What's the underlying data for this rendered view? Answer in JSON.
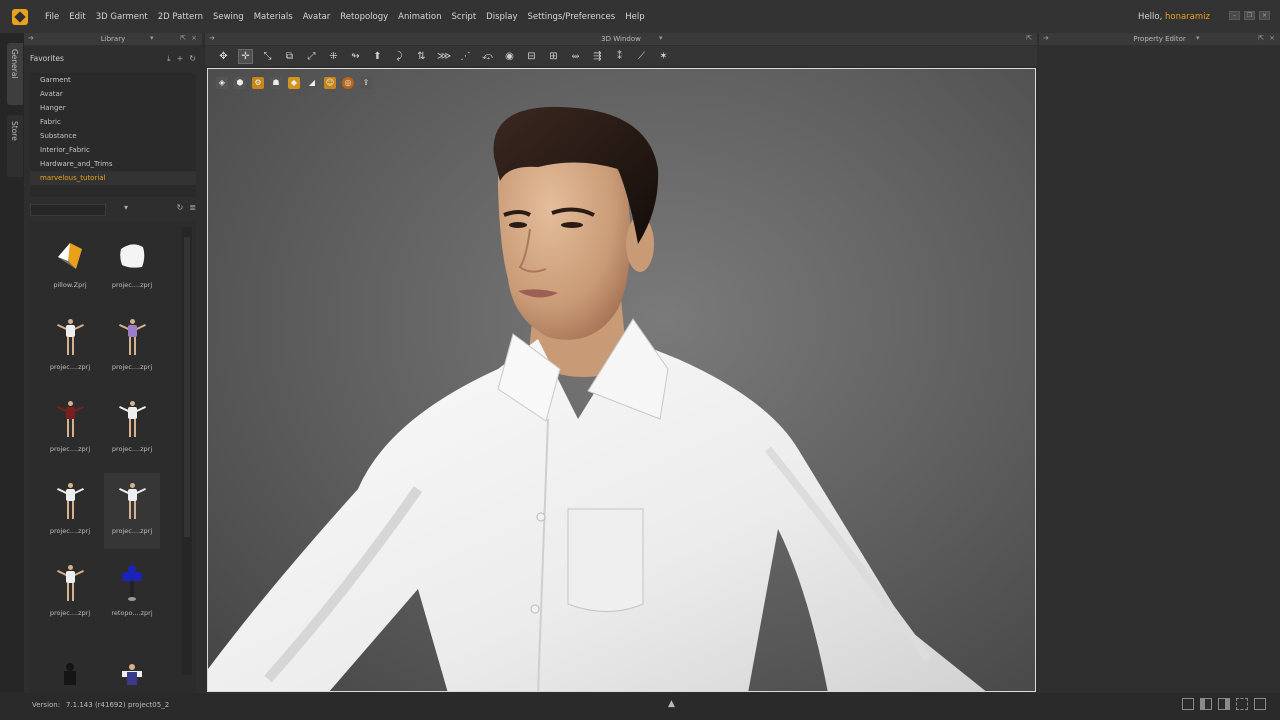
{
  "menu": {
    "items": [
      "File",
      "Edit",
      "3D Garment",
      "2D Pattern",
      "Sewing",
      "Materials",
      "Avatar",
      "Retopology",
      "Animation",
      "Script",
      "Display",
      "Settings/Preferences",
      "Help"
    ],
    "greeting": "Hello,",
    "username": "honaramiz"
  },
  "side_tabs": {
    "general": "General",
    "store": "Store"
  },
  "library": {
    "title": "Library",
    "favorites_label": "Favorites",
    "items": [
      "Garment",
      "Avatar",
      "Hanger",
      "Fabric",
      "Substance",
      "Interior_Fabric",
      "Hardware_and_Trims",
      "marvelous_tutorial"
    ],
    "active_index": 7,
    "thumbnails": [
      {
        "label": "pillow.Zprj",
        "icon": "pillow-colored-icon"
      },
      {
        "label": "projec....zprj",
        "icon": "pillow-white-icon"
      },
      {
        "label": "projec....zprj",
        "icon": "avatar-white-shirt-icon"
      },
      {
        "label": "projec....zprj",
        "icon": "avatar-purple-top-icon"
      },
      {
        "label": "projec....zprj",
        "icon": "avatar-red-shirt-icon"
      },
      {
        "label": "projec....zprj",
        "icon": "avatar-white-shirt-icon"
      },
      {
        "label": "projec....zprj",
        "icon": "avatar-white-shirt-icon"
      },
      {
        "label": "projec....zprj",
        "icon": "avatar-white-shirt-icon"
      },
      {
        "label": "projec....zprj",
        "icon": "avatar-white-shirt-icon"
      },
      {
        "label": "retopo....zprj",
        "icon": "avatar-blue-retopo-icon"
      }
    ]
  },
  "window3d": {
    "title": "3D Window"
  },
  "property_editor": {
    "title": "Property Editor"
  },
  "status": {
    "version_label": "Version:",
    "version": "7.1.143 (r41692)",
    "project": "project05_2"
  },
  "colors": {
    "accent": "#e8a21c",
    "shirt": "#f2f2f2",
    "skin": "#d7ad8a",
    "hair": "#2a1b15"
  }
}
